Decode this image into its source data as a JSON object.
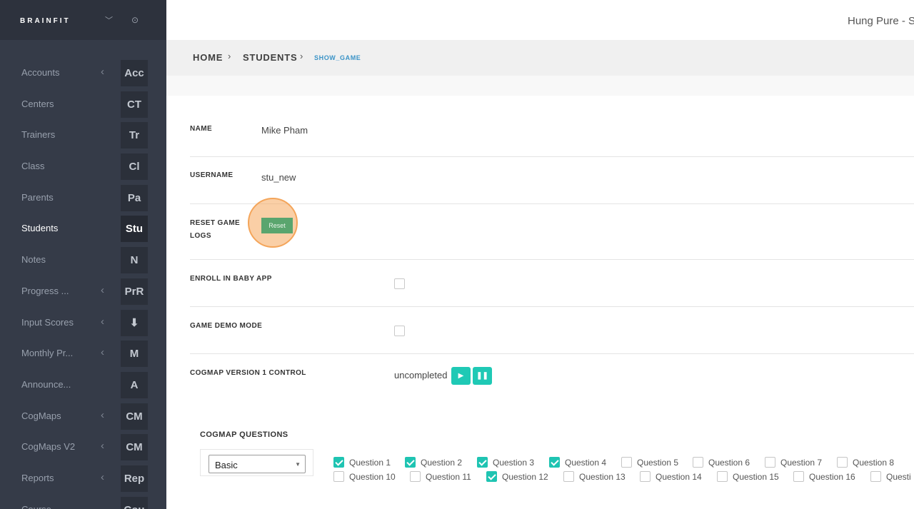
{
  "brand": "BRAINFIT",
  "user": {
    "name": "Hung Pure - S"
  },
  "nav": [
    {
      "label": "Accounts",
      "abbr": "Acc",
      "arrow": true,
      "active": false
    },
    {
      "label": "Centers",
      "abbr": "CT",
      "arrow": false,
      "active": false
    },
    {
      "label": "Trainers",
      "abbr": "Tr",
      "arrow": false,
      "active": false
    },
    {
      "label": "Class",
      "abbr": "Cl",
      "arrow": false,
      "active": false
    },
    {
      "label": "Parents",
      "abbr": "Pa",
      "arrow": false,
      "active": false
    },
    {
      "label": "Students",
      "abbr": "Stu",
      "arrow": false,
      "active": true
    },
    {
      "label": "Notes",
      "abbr": "N",
      "arrow": false,
      "active": false
    },
    {
      "label": "Progress ...",
      "abbr": "PrR",
      "arrow": true,
      "active": false
    },
    {
      "label": "Input Scores",
      "abbr": "⬇",
      "arrow": true,
      "active": false
    },
    {
      "label": "Monthly Pr...",
      "abbr": "M",
      "arrow": true,
      "active": false
    },
    {
      "label": "Announce...",
      "abbr": "A",
      "arrow": false,
      "active": false
    },
    {
      "label": "CogMaps",
      "abbr": "CM",
      "arrow": true,
      "active": false
    },
    {
      "label": "CogMaps V2",
      "abbr": "CM",
      "arrow": true,
      "active": false
    },
    {
      "label": "Reports",
      "abbr": "Rep",
      "arrow": true,
      "active": false
    },
    {
      "label": "Course",
      "abbr": "Cou",
      "arrow": false,
      "active": false
    }
  ],
  "breadcrumb": {
    "home": "HOME",
    "students": "STUDENTS",
    "current": "SHOW_GAME"
  },
  "form": {
    "name_label": "NAME",
    "name_value": "Mike Pham",
    "username_label": "USERNAME",
    "username_value": "stu_new",
    "reset_label_line1": "RESET GAME",
    "reset_label_line2": "LOGS",
    "reset_button": "Reset",
    "enroll_label": "ENROLL IN BABY APP",
    "enroll_checked": false,
    "demo_label": "GAME DEMO MODE",
    "demo_checked": false,
    "cogmap_label": "COGMAP VERSION 1 CONTROL",
    "cogmap_status": "uncompleted",
    "play_icon": "play-icon",
    "pause_icon": "pause-icon"
  },
  "cogmap_questions": {
    "title": "COGMAP QUESTIONS",
    "level_selected": "Basic",
    "row1": [
      {
        "label": "Question 1",
        "checked": true
      },
      {
        "label": "Question 2",
        "checked": true
      },
      {
        "label": "Question 3",
        "checked": true
      },
      {
        "label": "Question 4",
        "checked": true
      },
      {
        "label": "Question 5",
        "checked": false
      },
      {
        "label": "Question 6",
        "checked": false
      },
      {
        "label": "Question 7",
        "checked": false
      },
      {
        "label": "Question 8",
        "checked": false
      }
    ],
    "row2": [
      {
        "label": "Question 10",
        "checked": false
      },
      {
        "label": "Question 11",
        "checked": false
      },
      {
        "label": "Question 12",
        "checked": true
      },
      {
        "label": "Question 13",
        "checked": false
      },
      {
        "label": "Question 14",
        "checked": false
      },
      {
        "label": "Question 15",
        "checked": false
      },
      {
        "label": "Question 16",
        "checked": false
      },
      {
        "label": "Questi",
        "checked": false
      }
    ]
  }
}
